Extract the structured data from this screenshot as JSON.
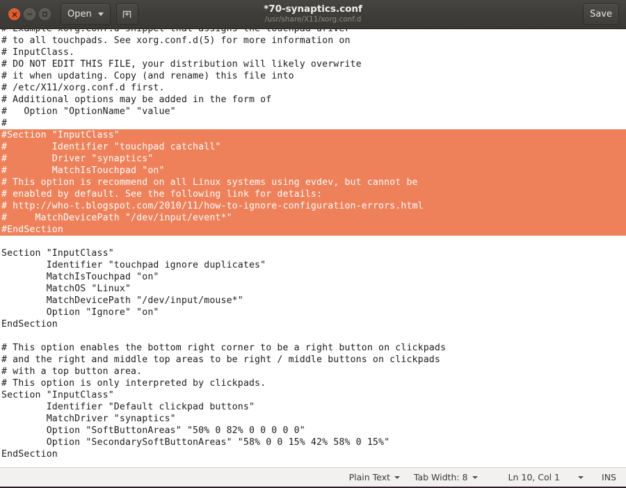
{
  "window": {
    "controls": [
      {
        "name": "close",
        "label": "Close",
        "color": "#E35B2C",
        "glyph": "x"
      },
      {
        "name": "minimize",
        "label": "Minimize",
        "color": "#5B5955",
        "glyph": "minus"
      },
      {
        "name": "maximize",
        "label": "Maximize",
        "color": "#5B5955",
        "glyph": "square"
      }
    ],
    "titlebar_color": "#403E3A"
  },
  "toolbar": {
    "open_label": "Open",
    "open_icon": "chevron-down-icon",
    "new_tab_icon": "new-document-icon",
    "save_label": "Save"
  },
  "title": {
    "filename": "*70-synaptics.conf",
    "path": "/usr/share/X11/xorg.conf.d"
  },
  "editor": {
    "selection_color": "#EE815A",
    "selection_text_color": "#FFFFFF",
    "lines": [
      {
        "text": "# Example xorg.conf.d snippet that assigns the touchpad driver",
        "selected": false
      },
      {
        "text": "# to all touchpads. See xorg.conf.d(5) for more information on",
        "selected": false
      },
      {
        "text": "# InputClass.",
        "selected": false
      },
      {
        "text": "# DO NOT EDIT THIS FILE, your distribution will likely overwrite",
        "selected": false
      },
      {
        "text": "# it when updating. Copy (and rename) this file into",
        "selected": false
      },
      {
        "text": "# /etc/X11/xorg.conf.d first.",
        "selected": false
      },
      {
        "text": "# Additional options may be added in the form of",
        "selected": false
      },
      {
        "text": "#   Option \"OptionName\" \"value\"",
        "selected": false
      },
      {
        "text": "#",
        "selected": false
      },
      {
        "text": "#Section \"InputClass\"",
        "selected": true
      },
      {
        "text": "#        Identifier \"touchpad catchall\"",
        "selected": true
      },
      {
        "text": "#        Driver \"synaptics\"",
        "selected": true
      },
      {
        "text": "#        MatchIsTouchpad \"on\"",
        "selected": true
      },
      {
        "text": "# This option is recommend on all Linux systems using evdev, but cannot be",
        "selected": true
      },
      {
        "text": "# enabled by default. See the following link for details:",
        "selected": true
      },
      {
        "text": "# http://who-t.blogspot.com/2010/11/how-to-ignore-configuration-errors.html",
        "selected": true
      },
      {
        "text": "#     MatchDevicePath \"/dev/input/event*\"",
        "selected": true
      },
      {
        "text": "#EndSection",
        "selected": true
      },
      {
        "text": "",
        "selected": false
      },
      {
        "text": "Section \"InputClass\"",
        "selected": false
      },
      {
        "text": "        Identifier \"touchpad ignore duplicates\"",
        "selected": false
      },
      {
        "text": "        MatchIsTouchpad \"on\"",
        "selected": false
      },
      {
        "text": "        MatchOS \"Linux\"",
        "selected": false
      },
      {
        "text": "        MatchDevicePath \"/dev/input/mouse*\"",
        "selected": false
      },
      {
        "text": "        Option \"Ignore\" \"on\"",
        "selected": false
      },
      {
        "text": "EndSection",
        "selected": false
      },
      {
        "text": "",
        "selected": false
      },
      {
        "text": "# This option enables the bottom right corner to be a right button on clickpads",
        "selected": false
      },
      {
        "text": "# and the right and middle top areas to be right / middle buttons on clickpads",
        "selected": false
      },
      {
        "text": "# with a top button area.",
        "selected": false
      },
      {
        "text": "# This option is only interpreted by clickpads.",
        "selected": false
      },
      {
        "text": "Section \"InputClass\"",
        "selected": false
      },
      {
        "text": "        Identifier \"Default clickpad buttons\"",
        "selected": false
      },
      {
        "text": "        MatchDriver \"synaptics\"",
        "selected": false
      },
      {
        "text": "        Option \"SoftButtonAreas\" \"50% 0 82% 0 0 0 0 0\"",
        "selected": false
      },
      {
        "text": "        Option \"SecondarySoftButtonAreas\" \"58% 0 0 15% 42% 58% 0 15%\"",
        "selected": false
      },
      {
        "text": "EndSection",
        "selected": false
      }
    ]
  },
  "statusbar": {
    "language": "Plain Text",
    "tab_width": "Tab Width: 8",
    "cursor_position": "Ln 10, Col 1",
    "insert_mode": "INS"
  }
}
